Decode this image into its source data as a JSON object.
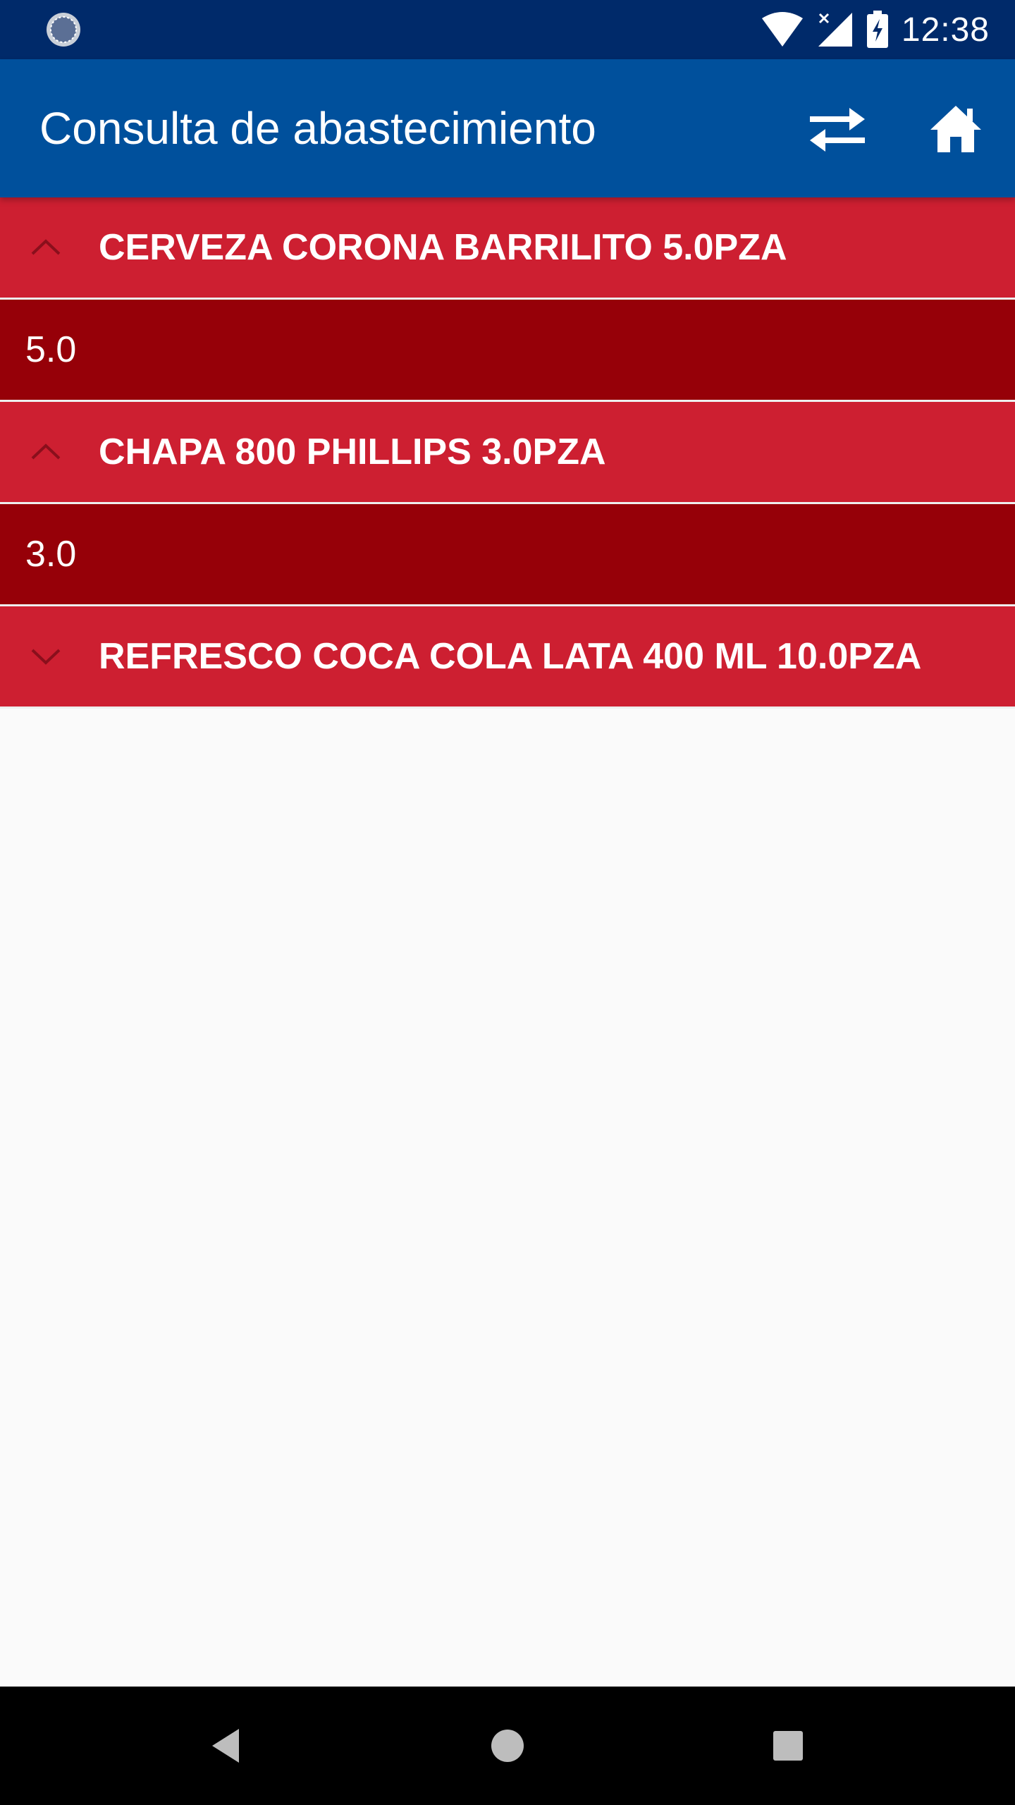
{
  "status_bar": {
    "time": "12:38",
    "icons": [
      "app-notification-icon",
      "wifi-icon",
      "signal-icon",
      "battery-charging-icon"
    ]
  },
  "app_bar": {
    "title": "Consulta de abastecimiento",
    "actions": [
      "swap-icon",
      "home-icon"
    ]
  },
  "groups": [
    {
      "title": "CERVEZA CORONA BARRILITO 5.0PZA",
      "expanded": true,
      "children": [
        "5.0"
      ]
    },
    {
      "title": "CHAPA 800 PHILLIPS 3.0PZA",
      "expanded": true,
      "children": [
        "3.0"
      ]
    },
    {
      "title": "REFRESCO COCA COLA LATA 400 ML 10.0PZA",
      "expanded": false,
      "children": []
    }
  ],
  "colors": {
    "status_bar": "#002a6a",
    "app_bar": "#00509c",
    "group_header": "#cd1f31",
    "child_row": "#960008",
    "background": "#fafafa"
  },
  "nav_bar": {
    "buttons": [
      "back-icon",
      "home-circle-icon",
      "recents-icon"
    ]
  }
}
